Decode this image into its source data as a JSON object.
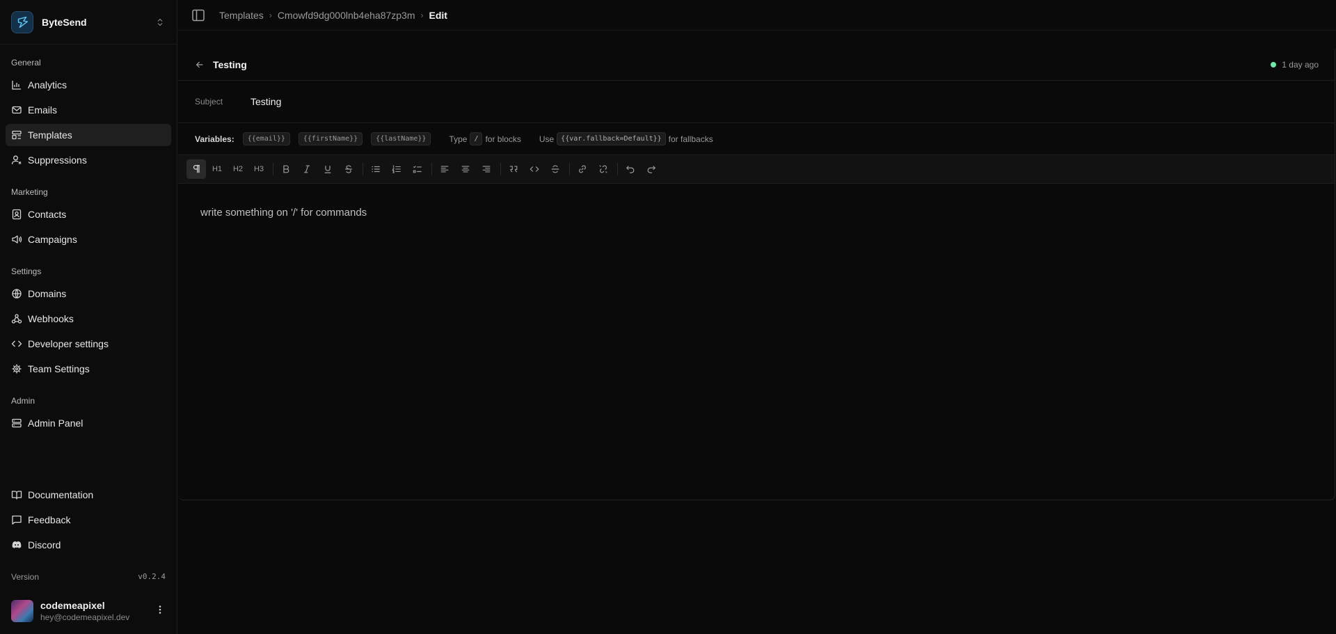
{
  "brand": {
    "name": "ByteSend"
  },
  "sidebar": {
    "groups": [
      {
        "label": "General",
        "items": [
          {
            "label": "Analytics",
            "icon": "bar-chart-icon"
          },
          {
            "label": "Emails",
            "icon": "mail-icon"
          },
          {
            "label": "Templates",
            "icon": "layout-template-icon",
            "active": true
          },
          {
            "label": "Suppressions",
            "icon": "user-x-icon"
          }
        ]
      },
      {
        "label": "Marketing",
        "items": [
          {
            "label": "Contacts",
            "icon": "contact-book-icon"
          },
          {
            "label": "Campaigns",
            "icon": "megaphone-icon"
          }
        ]
      },
      {
        "label": "Settings",
        "items": [
          {
            "label": "Domains",
            "icon": "globe-icon"
          },
          {
            "label": "Webhooks",
            "icon": "webhook-icon"
          },
          {
            "label": "Developer settings",
            "icon": "code-icon"
          },
          {
            "label": "Team Settings",
            "icon": "cog-icon"
          }
        ]
      },
      {
        "label": "Admin",
        "items": [
          {
            "label": "Admin Panel",
            "icon": "server-icon"
          }
        ]
      }
    ],
    "footer_links": [
      {
        "label": "Documentation",
        "icon": "book-open-icon"
      },
      {
        "label": "Feedback",
        "icon": "message-square-icon"
      },
      {
        "label": "Discord",
        "icon": "discord-icon"
      }
    ],
    "version_label": "Version",
    "version": "v0.2.4",
    "user": {
      "name": "codemeapixel",
      "email": "hey@codemeapixel.dev"
    }
  },
  "breadcrumb": {
    "root": "Templates",
    "id": "Cmowfd9dg000lnb4eha87zp3m",
    "current": "Edit"
  },
  "template": {
    "title": "Testing",
    "status_text": "1 day ago",
    "status_color": "#6ee7a8",
    "subject_label": "Subject",
    "subject_value": "Testing"
  },
  "variables": {
    "label": "Variables:",
    "chips": [
      "{{email}}",
      "{{firstName}}",
      "{{lastName}}"
    ],
    "hint1_pre": "Type",
    "hint1_key": "/",
    "hint1_post": "for blocks",
    "hint2_pre": "Use",
    "hint2_key": "{{var.fallback=Default}}",
    "hint2_post": "for fallbacks"
  },
  "toolbar": {
    "h1": "H1",
    "h2": "H2",
    "h3": "H3"
  },
  "editor": {
    "placeholder": "write something on '/' for commands"
  }
}
